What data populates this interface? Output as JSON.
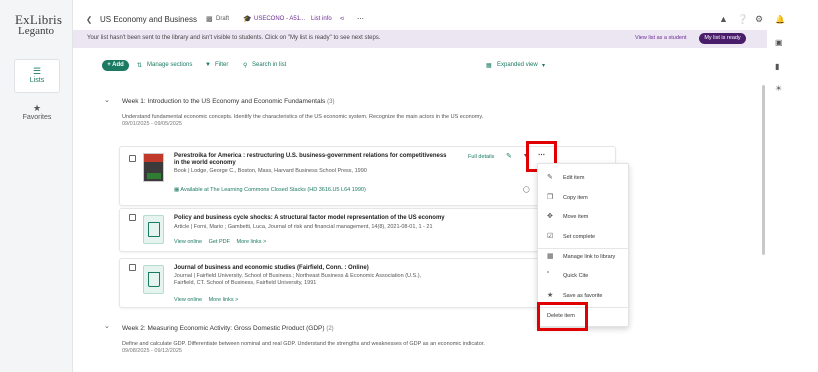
{
  "logo": {
    "line1": "ExLibris",
    "line2": "Leganto"
  },
  "left_nav": [
    {
      "icon": "list-icon",
      "label": "Lists",
      "active": true
    },
    {
      "icon": "star-icon",
      "label": "Favorites",
      "active": false
    }
  ],
  "header": {
    "back_icon": "chevron-left-icon",
    "title": "US Economy and Business",
    "draft": "Draft",
    "course": "USECONO - A51...",
    "list_info": "List info",
    "share_icon": "share-icon",
    "more_icon": "ellipsis-icon",
    "right_icons": [
      "hat-icon",
      "help-icon",
      "gear-icon",
      "bell-icon"
    ]
  },
  "right_rail_icons": [
    "bell-icon",
    "chat-icon",
    "bars-chart-icon",
    "lightbulb-icon"
  ],
  "banner": {
    "message": "Your list hasn't been sent to the library and isn't visible to students. Click on \"My list is ready\" to see next steps.",
    "view_as_student": "View list as a student",
    "ready_button": "My list is ready"
  },
  "toolbar": {
    "add": "+ Add",
    "manage_sections": "Manage sections",
    "filter": "Filter",
    "search": "Search in list",
    "expanded_view": "Expanded view"
  },
  "weeks": [
    {
      "title": "Week 1: Introduction to the US Economy and Economic Fundamentals",
      "count": "(3)",
      "description": "Understand fundamental economic concepts. Identify the characteristics of the US economic system. Recognize the main actors in the US economy.",
      "dates": "09/01/2025 - 09/05/2025"
    },
    {
      "title": "Week 2: Measuring Economic Activity: Gross Domestic Product (GDP)",
      "count": "(2)",
      "description": "Define and calculate GDP. Differentiate between nominal and real GDP. Understand the strengths and weaknesses of GDP as an economic indicator.",
      "dates": "09/08/2025 - 09/12/2025"
    }
  ],
  "items": [
    {
      "title_line1": "Perestroika for America : restructuring U.S. business-government relations for competitiveness",
      "title_line2": "in the world economy",
      "meta": "Book  |  Lodge, George C., Boston, Mass, Harvard Business School Press, 1990",
      "availability": "Available at The Learning Commons Closed Stacks (HD 3616.U5 L64 1990)",
      "full_details": "Full details"
    },
    {
      "title_line1": "Policy and business cycle shocks: A structural factor model representation of the US economy",
      "meta": "Article  |  Forni, Mario ; Gambetti, Luca, Journal of risk and financial management, 14(8), 2021-08-01, 1 - 21",
      "links": [
        "View online",
        "Get PDF",
        "More links >"
      ]
    },
    {
      "title_line1": "Journal of business and economic studies (Fairfield, Conn. : Online)",
      "meta_line1": "Journal  |  Fairfield University. School of Business.; Northeast Business & Economic Association (U.S.),",
      "meta_line2": "Fairfield, CT. School of Business, Fairfield University, 1991",
      "links": [
        "View online",
        "More links >"
      ]
    }
  ],
  "menu": [
    {
      "icon": "pencil-icon",
      "label": "Edit item"
    },
    {
      "icon": "copy-icon",
      "label": "Copy item"
    },
    {
      "icon": "move-icon",
      "label": "Move item"
    },
    {
      "icon": "check-circle-icon",
      "label": "Set complete"
    },
    {
      "icon": "library-icon",
      "label": "Manage link to library"
    },
    {
      "icon": "quote-icon",
      "label": "Quick Cite"
    },
    {
      "icon": "star-icon",
      "label": "Save as favorite"
    },
    {
      "icon": "",
      "label": "Delete item"
    }
  ],
  "colors": {
    "accent": "#1b7a62",
    "brand_purple": "#4a1d6b",
    "banner_bg": "#ece6f3",
    "highlight": "#e00000"
  }
}
